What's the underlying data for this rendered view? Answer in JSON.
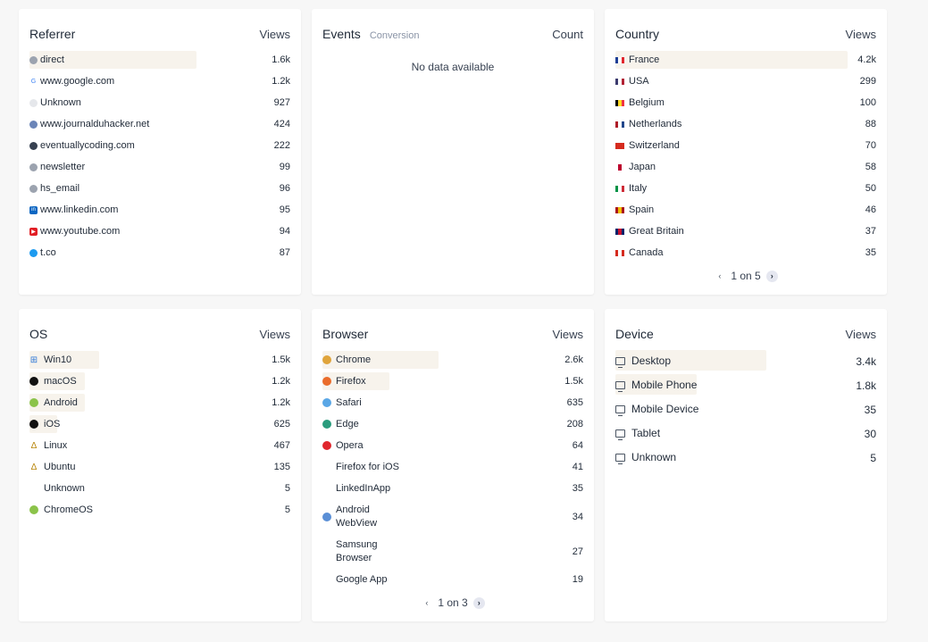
{
  "referrer": {
    "title": "Referrer",
    "metric": "Views",
    "rows": [
      {
        "label": "direct",
        "value": "1.6k",
        "pct": 0.72,
        "icon": "direct-icon",
        "glyph": "",
        "color": "#9ca3af"
      },
      {
        "label": "www.google.com",
        "value": "1.2k",
        "pct": 0.0,
        "icon": "google-icon",
        "glyph": "G",
        "color": "#ffffff"
      },
      {
        "label": "Unknown",
        "value": "927",
        "pct": 0.0,
        "icon": "unknown-icon",
        "glyph": "",
        "color": "#e5e7eb"
      },
      {
        "label": "www.journalduhacker.net",
        "value": "424",
        "pct": 0.0,
        "icon": "journalduhacker-icon",
        "glyph": "",
        "color": "#6b85b8"
      },
      {
        "label": "eventuallycoding.com",
        "value": "222",
        "pct": 0.0,
        "icon": "eventuallycoding-icon",
        "glyph": "",
        "color": "#374151"
      },
      {
        "label": "newsletter",
        "value": "99",
        "pct": 0.0,
        "icon": "newsletter-icon",
        "glyph": "",
        "color": "#9ca3af"
      },
      {
        "label": "hs_email",
        "value": "96",
        "pct": 0.0,
        "icon": "hs-email-icon",
        "glyph": "",
        "color": "#9ca3af"
      },
      {
        "label": "www.linkedin.com",
        "value": "95",
        "pct": 0.0,
        "icon": "linkedin-icon",
        "glyph": "in",
        "color": "#0a66c2"
      },
      {
        "label": "www.youtube.com",
        "value": "94",
        "pct": 0.0,
        "icon": "youtube-icon",
        "glyph": "▶",
        "color": "#e11d24"
      },
      {
        "label": "t.co",
        "value": "87",
        "pct": 0.0,
        "icon": "twitter-icon",
        "glyph": "",
        "color": "#1d9bf0"
      }
    ]
  },
  "events": {
    "title": "Events",
    "subtitle": "Conversion",
    "metric": "Count",
    "empty": "No data available"
  },
  "country": {
    "title": "Country",
    "metric": "Views",
    "rows": [
      {
        "label": "France",
        "value": "4.2k",
        "flag": [
          "#1f3f95",
          "#ffffff",
          "#e1262d"
        ],
        "pct": 1.0
      },
      {
        "label": "USA",
        "value": "299",
        "flag": [
          "#3c3b6e",
          "#ffffff",
          "#b22234"
        ],
        "pct": 0.0
      },
      {
        "label": "Belgium",
        "value": "100",
        "flag": [
          "#000000",
          "#fdda24",
          "#ef3340"
        ],
        "pct": 0.0
      },
      {
        "label": "Netherlands",
        "value": "88",
        "flag": [
          "#ae1c28",
          "#ffffff",
          "#21468b"
        ],
        "pct": 0.0
      },
      {
        "label": "Switzerland",
        "value": "70",
        "flag": [
          "#d52b1e",
          "#d52b1e",
          "#d52b1e"
        ],
        "pct": 0.0
      },
      {
        "label": "Japan",
        "value": "58",
        "flag": [
          "#ffffff",
          "#bc002d",
          "#ffffff"
        ],
        "pct": 0.0
      },
      {
        "label": "Italy",
        "value": "50",
        "flag": [
          "#009246",
          "#ffffff",
          "#ce2b37"
        ],
        "pct": 0.0
      },
      {
        "label": "Spain",
        "value": "46",
        "flag": [
          "#aa151b",
          "#f1bf00",
          "#aa151b"
        ],
        "pct": 0.0
      },
      {
        "label": "Great Britain",
        "value": "37",
        "flag": [
          "#012169",
          "#c8102e",
          "#012169"
        ],
        "pct": 0.0
      },
      {
        "label": "Canada",
        "value": "35",
        "flag": [
          "#d52b1e",
          "#ffffff",
          "#d52b1e"
        ],
        "pct": 0.0
      }
    ],
    "pager": "1 on 5"
  },
  "os": {
    "title": "OS",
    "metric": "Views",
    "rows": [
      {
        "label": "Win10",
        "value": "1.5k",
        "pct": 0.3,
        "icon": "windows-icon",
        "glyph": "⊞",
        "color": "#2f78d6"
      },
      {
        "label": "macOS",
        "value": "1.2k",
        "pct": 0.24,
        "icon": "apple-icon",
        "glyph": "",
        "color": "#111111"
      },
      {
        "label": "Android",
        "value": "1.2k",
        "pct": 0.24,
        "icon": "android-icon",
        "glyph": "",
        "color": "#8bc34a"
      },
      {
        "label": "iOS",
        "value": "625",
        "pct": 0.12,
        "icon": "apple-icon",
        "glyph": "",
        "color": "#111111"
      },
      {
        "label": "Linux",
        "value": "467",
        "pct": 0.0,
        "icon": "linux-icon",
        "glyph": "Δ",
        "color": "#b8860b"
      },
      {
        "label": "Ubuntu",
        "value": "135",
        "pct": 0.0,
        "icon": "ubuntu-icon",
        "glyph": "Δ",
        "color": "#b8860b"
      },
      {
        "label": "Unknown",
        "value": "5",
        "pct": 0.0,
        "icon": "unknown-icon",
        "glyph": "",
        "color": "#ffffff"
      },
      {
        "label": "ChromeOS",
        "value": "5",
        "pct": 0.0,
        "icon": "android-icon",
        "glyph": "",
        "color": "#8bc34a"
      }
    ]
  },
  "browser": {
    "title": "Browser",
    "metric": "Views",
    "rows": [
      {
        "label": "Chrome",
        "value": "2.6k",
        "pct": 0.5,
        "icon": "chrome-icon",
        "color": "#e0a43b"
      },
      {
        "label": "Firefox",
        "value": "1.5k",
        "pct": 0.29,
        "icon": "firefox-icon",
        "color": "#ea6c2b"
      },
      {
        "label": "Safari",
        "value": "635",
        "pct": 0.0,
        "icon": "safari-icon",
        "color": "#5aa7e6"
      },
      {
        "label": "Edge",
        "value": "208",
        "pct": 0.0,
        "icon": "edge-icon",
        "color": "#2a9c7d"
      },
      {
        "label": "Opera",
        "value": "64",
        "pct": 0.0,
        "icon": "opera-icon",
        "color": "#e0262d"
      },
      {
        "label": "Firefox for iOS",
        "value": "41",
        "pct": 0.0,
        "icon": "none",
        "color": ""
      },
      {
        "label": "LinkedInApp",
        "value": "35",
        "pct": 0.0,
        "icon": "none",
        "color": ""
      },
      {
        "label": "Android\nWebView",
        "value": "34",
        "pct": 0.0,
        "icon": "webview-icon",
        "color": "#5a8fd6"
      },
      {
        "label": "Samsung\nBrowser",
        "value": "27",
        "pct": 0.0,
        "icon": "none",
        "color": ""
      },
      {
        "label": "Google App",
        "value": "19",
        "pct": 0.0,
        "icon": "none",
        "color": ""
      }
    ],
    "pager": "1 on 3"
  },
  "device": {
    "title": "Device",
    "metric": "Views",
    "rows": [
      {
        "label": "Desktop",
        "value": "3.4k",
        "pct": 0.65
      },
      {
        "label": "Mobile Phone",
        "value": "1.8k",
        "pct": 0.35
      },
      {
        "label": "Mobile Device",
        "value": "35",
        "pct": 0.0
      },
      {
        "label": "Tablet",
        "value": "30",
        "pct": 0.0
      },
      {
        "label": "Unknown",
        "value": "5",
        "pct": 0.0
      }
    ]
  }
}
